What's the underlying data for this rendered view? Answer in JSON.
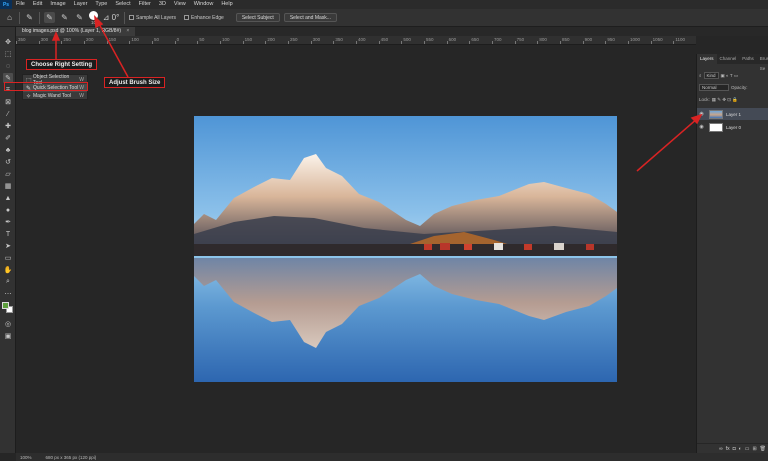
{
  "menu": {
    "logo": "Ps",
    "items": [
      "File",
      "Edit",
      "Image",
      "Layer",
      "Type",
      "Select",
      "Filter",
      "3D",
      "View",
      "Window",
      "Help"
    ]
  },
  "options": {
    "brush_size": "10",
    "sample_all_layers": "Sample All Layers",
    "enhance_edge": "Enhance Edge",
    "select_subject": "Select Subject",
    "select_and_mask": "Select and Mask..."
  },
  "document": {
    "tab_title": "blog images.psd @ 100% (Layer 1, RGB/8#)",
    "tab_close": "×"
  },
  "ruler": {
    "labels": [
      "350",
      "300",
      "250",
      "200",
      "150",
      "100",
      "50",
      "0",
      "50",
      "100",
      "150",
      "200",
      "250",
      "300",
      "350",
      "400",
      "450",
      "500",
      "550",
      "600",
      "650",
      "700",
      "750",
      "800",
      "850",
      "900",
      "950",
      "1000",
      "1050",
      "1100"
    ]
  },
  "flyout": {
    "items": [
      {
        "label": "Object Selection Tool",
        "key": "W"
      },
      {
        "label": "Quick Selection Tool",
        "key": "W"
      },
      {
        "label": "Magic Wand Tool",
        "key": "W"
      }
    ]
  },
  "callouts": {
    "choose_setting": "Choose Right Setting",
    "adjust_brush": "Adjust Brush Size"
  },
  "layers_panel": {
    "tabs": [
      "Layers",
      "Channel",
      "Paths",
      "Brush Se"
    ],
    "kind_filter": "Kind",
    "blend_mode": "Normal",
    "opacity_label": "Opacity:",
    "lock_label": "Lock:",
    "layers": [
      {
        "name": "Layer 1",
        "selected": true
      },
      {
        "name": "Layer 0",
        "selected": false
      }
    ]
  },
  "status": {
    "zoom": "100%",
    "doc_size": "680 px x 365 px (120 ppi)"
  },
  "colors": {
    "accent_red": "#d92323",
    "foreground_swatch": "#5c9e3c",
    "background_swatch": "#ffffff"
  }
}
